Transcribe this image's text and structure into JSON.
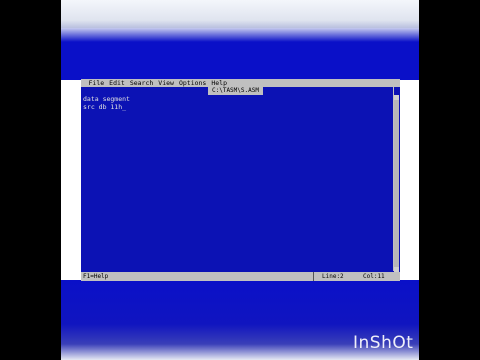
{
  "editor": {
    "menu": [
      "File",
      "Edit",
      "Search",
      "View",
      "Options",
      "Help"
    ],
    "filename": "C:\\TASM\\S.ASM",
    "lines": [
      "data segment",
      "src db 11h"
    ],
    "cursor": "_"
  },
  "status": {
    "help": "F1=Help",
    "line": "Line:2",
    "col": "Col:11"
  },
  "watermark": "InShOt",
  "colors": {
    "editor_bg": "#0c12b4",
    "bar_gray": "#c0c0c0",
    "text": "#e0e0e0"
  }
}
